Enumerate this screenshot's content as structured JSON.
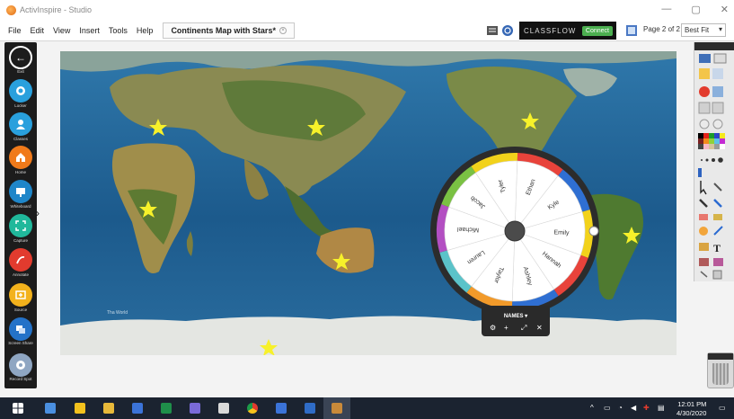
{
  "window": {
    "title": "ActivInspire - Studio",
    "controls": {
      "minimize": "—",
      "maximize": "▢",
      "close": "✕"
    }
  },
  "menu": {
    "items": [
      "File",
      "Edit",
      "View",
      "Insert",
      "Tools",
      "Help"
    ],
    "document_tab": "Continents Map with Stars*"
  },
  "classflow": {
    "brand": "CLASSFLOW",
    "connect_label": "Connect"
  },
  "page_indicator": "Page 2 of 2",
  "zoom": {
    "value": "Best Fit"
  },
  "left_toolbar": {
    "buttons": [
      {
        "label": "Exit",
        "icon": "back-arrow-icon",
        "color": "#1c1c1c"
      },
      {
        "label": "Locker",
        "icon": "locker-icon",
        "color": "#29a0dd"
      },
      {
        "label": "Classes",
        "icon": "user-icon",
        "color": "#29a0dd"
      },
      {
        "label": "Home",
        "icon": "home-icon",
        "color": "#f07a1a"
      },
      {
        "label": "Whiteboard",
        "icon": "whiteboard-icon",
        "color": "#1f86c9"
      },
      {
        "label": "Capture",
        "icon": "capture-icon",
        "color": "#20b89b"
      },
      {
        "label": "Annotate",
        "icon": "annotate-icon",
        "color": "#e23b2e"
      },
      {
        "label": "Source",
        "icon": "source-icon",
        "color": "#f3b21c"
      },
      {
        "label": "Screen Share",
        "icon": "screen-share-icon",
        "color": "#2472c8"
      },
      {
        "label": "Record Spot",
        "icon": "record-icon",
        "color": "#8fa6c2"
      }
    ]
  },
  "spinner": {
    "title": "NAMES",
    "names": [
      "Ethan",
      "Kyle",
      "Emily",
      "Hannah",
      "Ashley",
      "Taylor",
      "Lauren",
      "Michael",
      "Jacob",
      "Tyler"
    ],
    "segment_colors": [
      "#e8433b",
      "#2f6fd2",
      "#f2d21b",
      "#e8433b",
      "#2f6fd2",
      "#f29a2a",
      "#5bc3c9",
      "#b34fc2",
      "#7ac143",
      "#f2d21b"
    ],
    "controls": {
      "settings": "⚙",
      "add": "+",
      "expand": "⤢",
      "close": "✕"
    }
  },
  "map": {
    "ocean_color": "#1f5f93",
    "star_color": "#f7f12a",
    "watermark": "Tha World"
  },
  "taskbar": {
    "time": "12:01 PM",
    "date": "4/30/2020"
  }
}
